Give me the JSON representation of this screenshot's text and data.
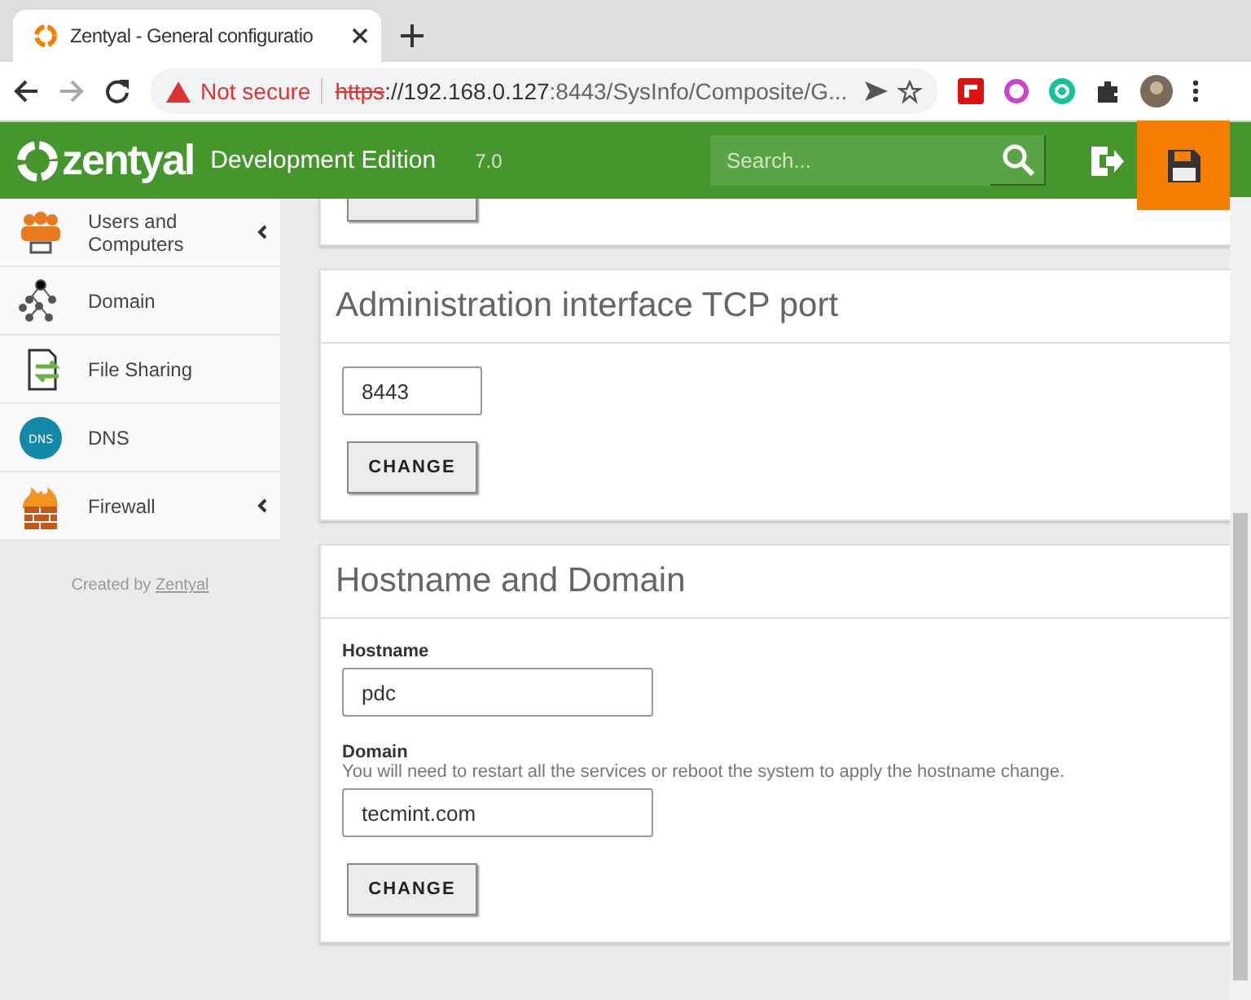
{
  "browser": {
    "tab_title": "Zentyal - General configuratio",
    "url_warning": "Not secure",
    "url_scheme": "https",
    "url_rest": "://192.168.0.127",
    "url_port_path": ":8443/SysInfo/Composite/G..."
  },
  "header": {
    "brand": "zentyal",
    "edition": "Development Edition",
    "version": "7.0",
    "search": {
      "placeholder": "Search..."
    }
  },
  "sidebar": {
    "items": [
      {
        "kind": "users",
        "label": "Users and Computers",
        "has_submenu": true
      },
      {
        "kind": "domain",
        "label": "Domain",
        "has_submenu": false
      },
      {
        "kind": "files",
        "label": "File Sharing",
        "has_submenu": false
      },
      {
        "kind": "dns",
        "label": "DNS",
        "icon_text": "DNS",
        "has_submenu": false
      },
      {
        "kind": "firewall",
        "label": "Firewall",
        "has_submenu": true
      }
    ],
    "footer": {
      "text": "Created by",
      "link": "Zentyal"
    }
  },
  "cards": [
    {
      "kind": "stub"
    },
    {
      "kind": "form",
      "title": "Administration interface TCP port",
      "fields": [
        {
          "value": "8443",
          "short": true
        }
      ],
      "button": "CHANGE"
    },
    {
      "kind": "form",
      "title": "Hostname and Domain",
      "fields": [
        {
          "label": "Hostname",
          "value": "pdc"
        },
        {
          "label": "Domain",
          "hint": "You will need to restart all the services or reboot the system to apply the hostname change.",
          "value": "tecmint.com"
        }
      ],
      "button": "CHANGE"
    }
  ]
}
